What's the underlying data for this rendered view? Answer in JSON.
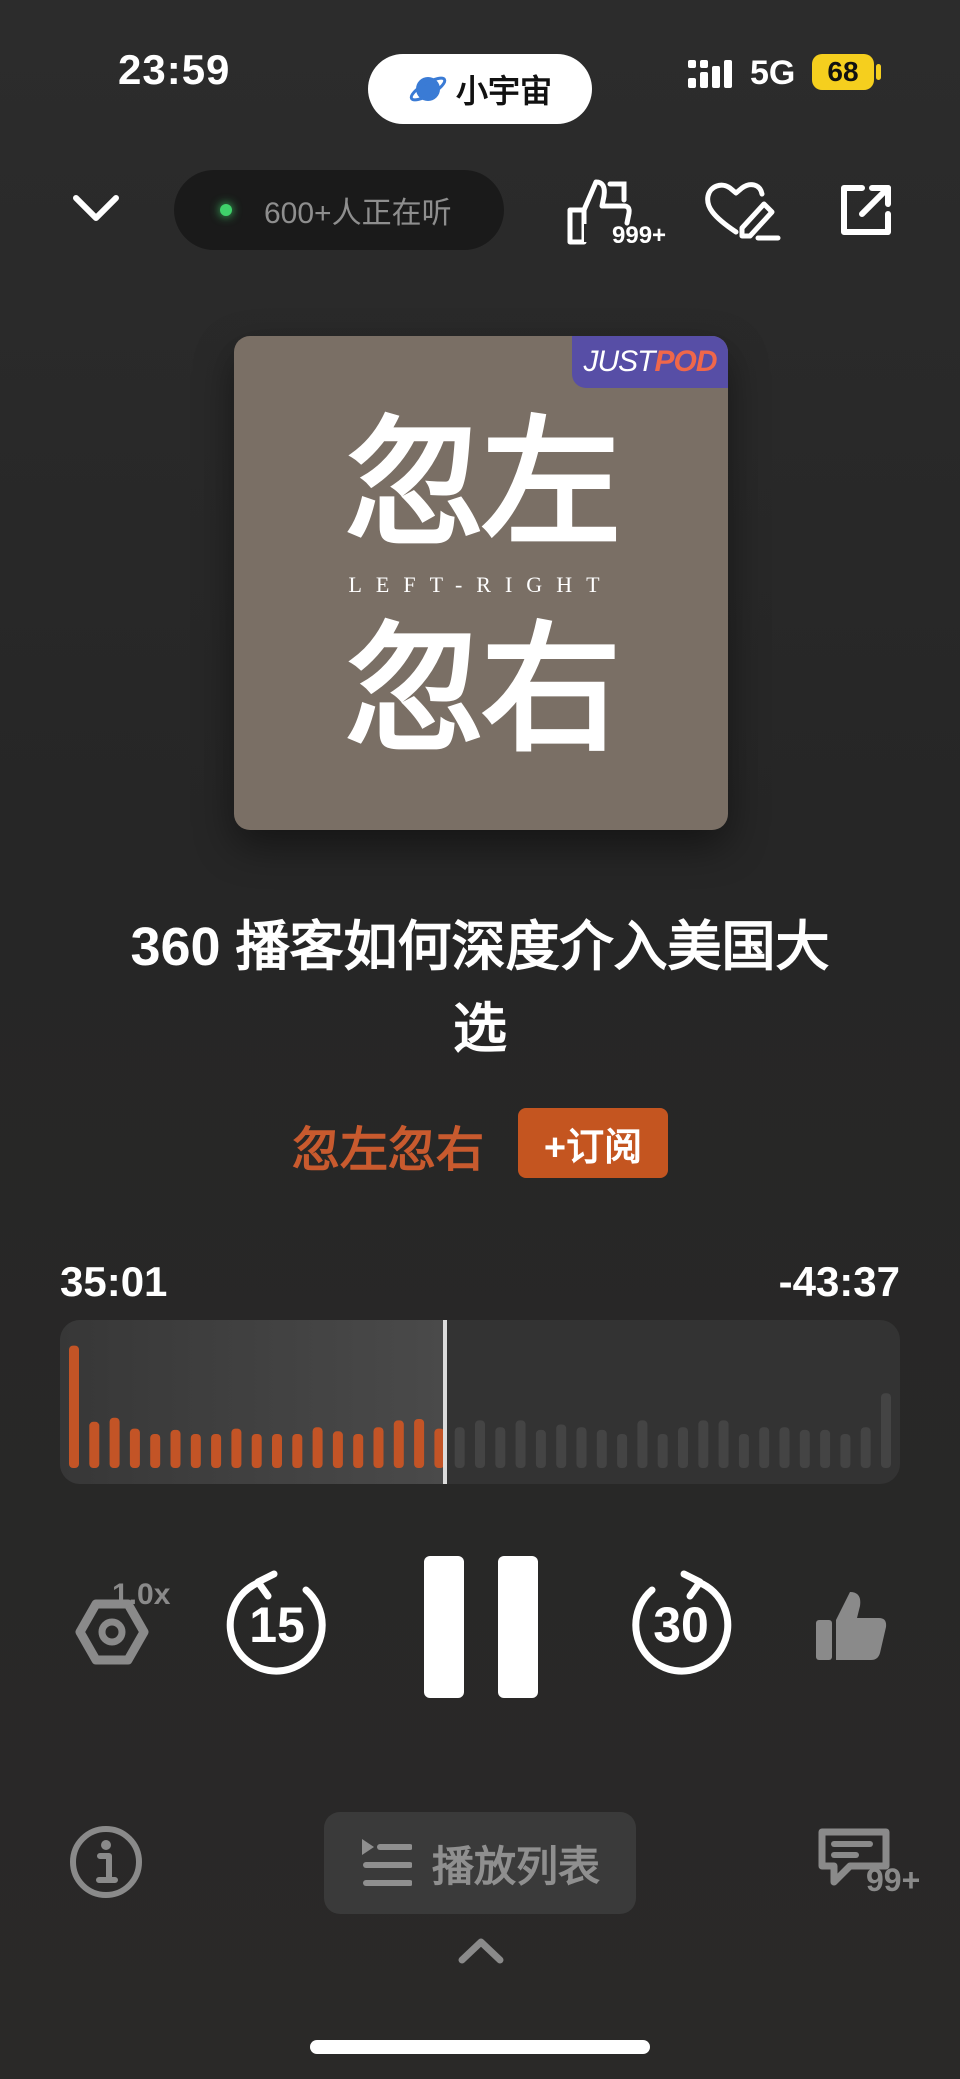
{
  "status_bar": {
    "time": "23:59",
    "app_pill": "小宇宙",
    "network": "5G",
    "battery": "68"
  },
  "top_bar": {
    "listeners": "600+人正在听",
    "like_count": "999+"
  },
  "cover": {
    "badge_part1": "JUST",
    "badge_part2": "POD",
    "title_top": "忽左",
    "title_bottom": "忽右",
    "subtitle_en": "LEFT-RIGHT"
  },
  "episode": {
    "title_line1": "360 播客如何深度介入美国大",
    "title_line2": "选"
  },
  "podcast": {
    "name": "忽左忽右",
    "subscribe_label": "+订阅"
  },
  "progress": {
    "elapsed": "35:01",
    "remaining": "-43:37",
    "played_fraction": 0.458,
    "played_color": "#c35426",
    "unplayed_color": "#444444",
    "bars": [
      0.9,
      0.34,
      0.37,
      0.29,
      0.25,
      0.28,
      0.25,
      0.25,
      0.29,
      0.25,
      0.25,
      0.25,
      0.3,
      0.27,
      0.25,
      0.3,
      0.35,
      0.36,
      0.29,
      0.3,
      0.35,
      0.3,
      0.35,
      0.28,
      0.32,
      0.3,
      0.28,
      0.25,
      0.35,
      0.25,
      0.3,
      0.35,
      0.35,
      0.25,
      0.3,
      0.3,
      0.28,
      0.28,
      0.25,
      0.3,
      0.55
    ]
  },
  "controls": {
    "speed": "1.0x",
    "rewind_seconds": "15",
    "forward_seconds": "30",
    "state": "playing"
  },
  "bottom": {
    "playlist_label": "播放列表",
    "comment_count": "99+"
  },
  "icons": {
    "top_left": "chevron-down-icon",
    "like_top": "thumb-up-icon",
    "favorite": "heart-edit-icon",
    "share": "share-icon",
    "speed": "speed-icon",
    "rewind": "rewind-15-icon",
    "pause": "pause-icon",
    "forward": "forward-30-icon",
    "thumb": "thumb-up-icon",
    "info": "info-icon",
    "playlist": "playlist-icon",
    "comment": "comment-icon",
    "expand": "chevron-up-icon"
  }
}
